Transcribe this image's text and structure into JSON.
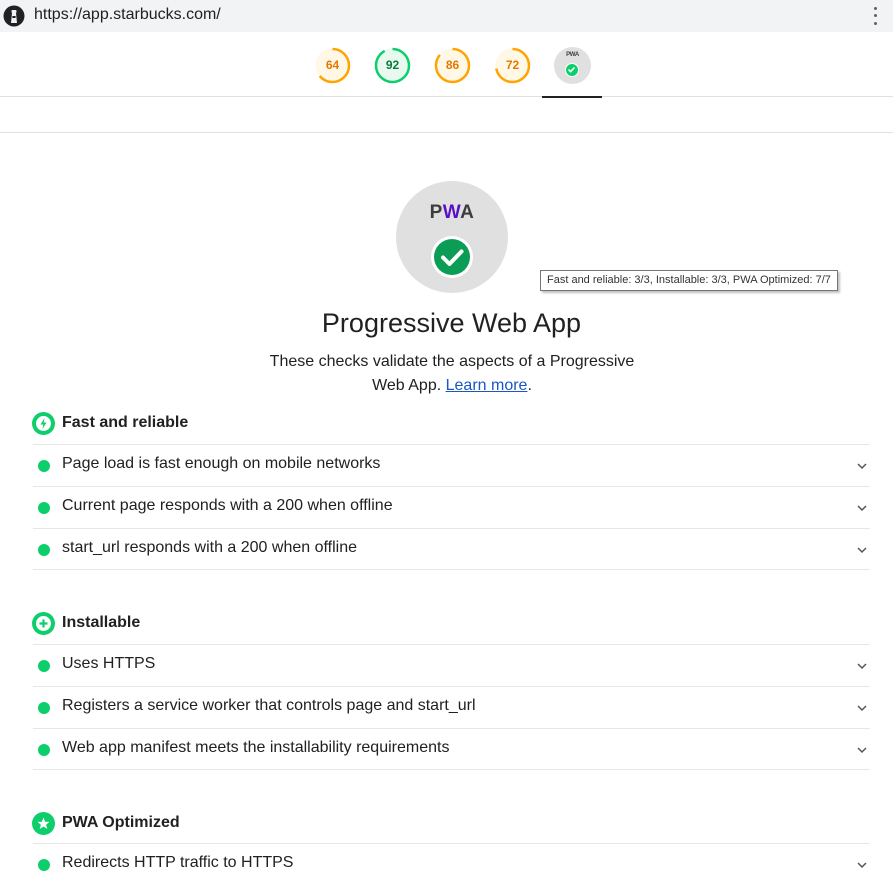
{
  "browser": {
    "url": "https://app.starbucks.com/",
    "logo_icon": "lighthouse-icon",
    "menu_icon": "kebab-menu-icon"
  },
  "score_gauges": [
    {
      "value": "64",
      "score": 0.64,
      "status": "average",
      "color": "#ffa400"
    },
    {
      "value": "92",
      "score": 0.92,
      "status": "pass",
      "color": "#0cce6b"
    },
    {
      "value": "86",
      "score": 0.86,
      "status": "average",
      "color": "#ffa400"
    },
    {
      "value": "72",
      "score": 0.72,
      "status": "average",
      "color": "#ffa400"
    }
  ],
  "pwa_gauge": {
    "badge_text": "PWA",
    "icon": "check-circle-icon",
    "selected": true
  },
  "pwa_badge": {
    "text_p": "P",
    "text_w": "W",
    "text_a": "A",
    "icon": "check-circle-icon",
    "tooltip": "Fast and reliable: 3/3, Installable: 3/3, PWA Optimized: 7/7"
  },
  "category": {
    "title": "Progressive Web App",
    "description": "These checks validate the aspects of a Progressive Web App.",
    "learn_more": "Learn more",
    "period": "."
  },
  "groups": [
    {
      "title": "Fast and reliable",
      "icon": "lightning-bolt-icon",
      "audits": [
        "Page load is fast enough on mobile networks",
        "Current page responds with a 200 when offline",
        "start_url responds with a 200 when offline"
      ]
    },
    {
      "title": "Installable",
      "icon": "plus-icon",
      "audits": [
        "Uses HTTPS",
        "Registers a service worker that controls page and start_url",
        "Web app manifest meets the installability requirements"
      ]
    },
    {
      "title": "PWA Optimized",
      "icon": "star-icon",
      "audits": [
        "Redirects HTTP traffic to HTTPS"
      ]
    }
  ],
  "colors": {
    "pass": "#0cce6b",
    "average": "#ffa400",
    "link": "#1a56c4",
    "pwa_purple": "#5a0fc8"
  }
}
